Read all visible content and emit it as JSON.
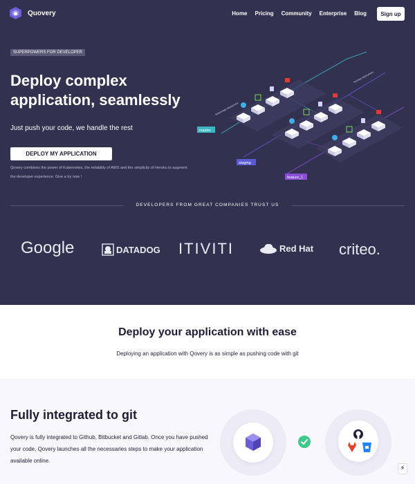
{
  "nav": {
    "brand": "Quovery",
    "links": [
      "Home",
      "Pricing",
      "Community",
      "Enterprise",
      "Blog"
    ],
    "signup_label": "Sign up"
  },
  "hero": {
    "tag": "SUPERPOWERS FOR DEVELOPER",
    "title": "Deploy complex application, seamlessly",
    "subtitle": "Just push your code, we handle the rest",
    "cta_label": "DEPLOY MY APPLICATION",
    "description": "Qovery combines the power of Kubernetes, the reliability of AWS and the simplicity of Heroku to augment the developer experience. Give a try now !",
    "branches": [
      "master",
      "staging",
      "feature_1"
    ],
    "commit_labels": [
      "feature/app-deployment",
      "feat/app-deployment"
    ]
  },
  "trust": {
    "heading": "DEVELOPERS FROM GREAT COMPANIES TRUST US",
    "companies": [
      "Google",
      "DATADOG",
      "ITIVITI",
      "Red Hat",
      "criteo."
    ]
  },
  "ease": {
    "title": "Deploy your application with ease",
    "subtitle": "Deploying an application with Qovery is as simple as pushing code with git"
  },
  "git": {
    "title": "Fully integrated to git",
    "body": "Qovery is fully integrated to Github, Bitbucket and Gitlab. Once you have pushed your code, Qovery launches all the necessaries steps to make your application available online.",
    "providers": [
      "github-icon",
      "gitlab-icon",
      "bitbucket-icon"
    ]
  },
  "colors": {
    "hero_bg": "#333150",
    "accent_purple": "#7b61ff",
    "branch_master": "#3ab7bf",
    "branch_staging": "#5b5bd6",
    "branch_feature": "#8a4fd8",
    "check_green": "#3ec98a"
  }
}
